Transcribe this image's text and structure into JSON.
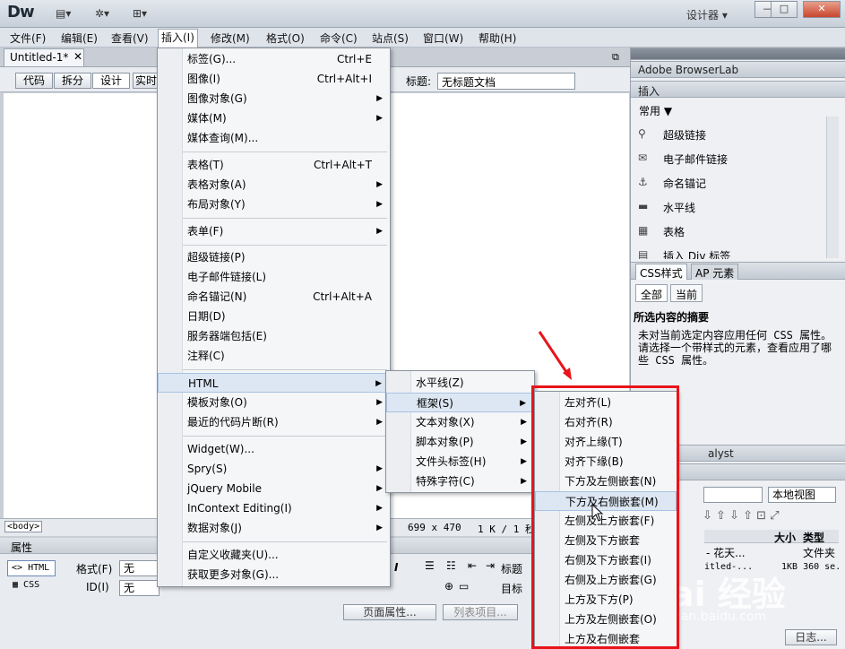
{
  "app": {
    "logo": "Dw",
    "designer": "设计器",
    "win_min": "—",
    "win_max": "□",
    "win_close": "✕"
  },
  "menubar": [
    "文件(F)",
    "编辑(E)",
    "查看(V)",
    "插入(I)",
    "修改(M)",
    "格式(O)",
    "命令(C)",
    "站点(S)",
    "窗口(W)",
    "帮助(H)"
  ],
  "doc": {
    "tab": "Untitled-1*",
    "views": [
      "代码",
      "拆分",
      "设计",
      "实时"
    ],
    "title_label": "标题:",
    "title_value": "无标题文档"
  },
  "status": {
    "body_tag": "<body>",
    "size": "699 x 470",
    "kb": "1 K / 1 秒"
  },
  "props": {
    "header": "属性",
    "html": "HTML",
    "css": "CSS",
    "format_label": "格式(F)",
    "format_value": "无",
    "id_label": "ID(I)",
    "id_value": "无",
    "heading_label": "标题",
    "target_label": "目标",
    "page_props": "页面属性...",
    "list_items": "列表项目..."
  },
  "insert_menu": {
    "items": [
      {
        "label": "标签(G)...",
        "shortcut": "Ctrl+E"
      },
      {
        "label": "图像(I)",
        "shortcut": "Ctrl+Alt+I"
      },
      {
        "label": "图像对象(G)",
        "arrow": "▶"
      },
      {
        "label": "媒体(M)",
        "arrow": "▶"
      },
      {
        "label": "媒体查询(M)..."
      },
      {
        "label": "表格(T)",
        "shortcut": "Ctrl+Alt+T"
      },
      {
        "label": "表格对象(A)",
        "arrow": "▶"
      },
      {
        "label": "布局对象(Y)",
        "arrow": "▶"
      },
      {
        "label": "表单(F)",
        "arrow": "▶"
      },
      {
        "label": "超级链接(P)"
      },
      {
        "label": "电子邮件链接(L)"
      },
      {
        "label": "命名锚记(N)",
        "shortcut": "Ctrl+Alt+A"
      },
      {
        "label": "日期(D)"
      },
      {
        "label": "服务器端包括(E)"
      },
      {
        "label": "注释(C)"
      },
      {
        "label": "HTML",
        "arrow": "▶"
      },
      {
        "label": "模板对象(O)",
        "arrow": "▶"
      },
      {
        "label": "最近的代码片断(R)",
        "arrow": "▶"
      },
      {
        "label": "Widget(W)..."
      },
      {
        "label": "Spry(S)",
        "arrow": "▶"
      },
      {
        "label": "jQuery Mobile",
        "arrow": "▶"
      },
      {
        "label": "InContext Editing(I)",
        "arrow": "▶"
      },
      {
        "label": "数据对象(J)",
        "arrow": "▶"
      },
      {
        "label": "自定义收藏夹(U)..."
      },
      {
        "label": "获取更多对象(G)..."
      }
    ]
  },
  "html_menu": {
    "items": [
      {
        "label": "水平线(Z)"
      },
      {
        "label": "框架(S)",
        "arrow": "▶"
      },
      {
        "label": "文本对象(X)",
        "arrow": "▶"
      },
      {
        "label": "脚本对象(P)",
        "arrow": "▶"
      },
      {
        "label": "文件头标签(H)",
        "arrow": "▶"
      },
      {
        "label": "特殊字符(C)",
        "arrow": "▶"
      }
    ]
  },
  "frame_menu": {
    "items": [
      "左对齐(L)",
      "右对齐(R)",
      "对齐上缘(T)",
      "对齐下缘(B)",
      "下方及左侧嵌套(N)",
      "下方及右侧嵌套(M)",
      "左侧及上方嵌套(F)",
      "左侧及下方嵌套",
      "右侧及下方嵌套(I)",
      "右侧及上方嵌套(G)",
      "上方及下方(P)",
      "上方及左侧嵌套(O)",
      "上方及右侧嵌套"
    ]
  },
  "right_panel": {
    "browserlab": "Adobe BrowserLab",
    "insert_header": "插入",
    "category": "常用",
    "insert_items": [
      "超级链接",
      "电子邮件链接",
      "命名锚记",
      "水平线",
      "表格",
      "插入 Div 标签"
    ],
    "css_tab": "CSS样式",
    "ap_tab": "AP 元素",
    "all_btn": "全部",
    "current_btn": "当前",
    "summary_title": "所选内容的摘要",
    "summary_text": "未对当前选定内容应用任何 CSS 属性。请选择一个带样式的元素，查看应用了哪些 CSS 属性。",
    "analyst": "alyst",
    "local_view": "本地视图",
    "col_size": "大小",
    "col_type": "类型",
    "row1_a": "- 花天...",
    "row1_b": "文件夹",
    "row2_a": "itled-...",
    "row2_b": "1KB 360 se.",
    "log_btn": "日志..."
  },
  "watermark": {
    "main": "Bai 经验",
    "sub": "jingyan.baidu.com"
  }
}
